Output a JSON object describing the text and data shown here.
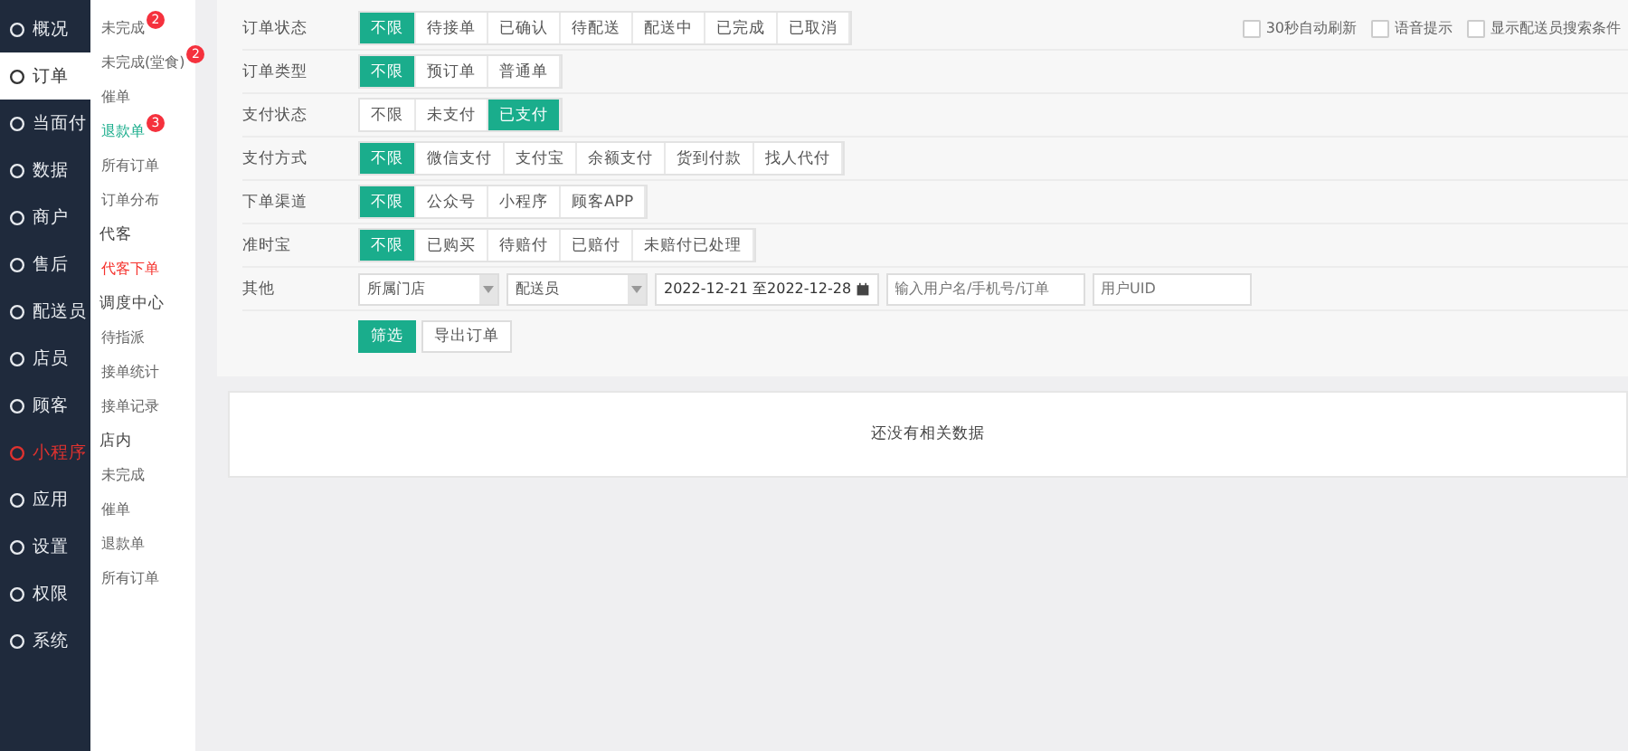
{
  "sidebar": {
    "items": [
      {
        "label": "概况",
        "selected": false
      },
      {
        "label": "订单",
        "selected": true
      },
      {
        "label": "当面付",
        "selected": false
      },
      {
        "label": "数据",
        "selected": false
      },
      {
        "label": "商户",
        "selected": false
      },
      {
        "label": "售后",
        "selected": false
      },
      {
        "label": "配送员",
        "selected": false
      },
      {
        "label": "店员",
        "selected": false
      },
      {
        "label": "顾客",
        "selected": false
      },
      {
        "label": "小程序",
        "selected": false,
        "color": "#e0322f"
      },
      {
        "label": "应用",
        "selected": false
      },
      {
        "label": "设置",
        "selected": false
      },
      {
        "label": "权限",
        "selected": false
      },
      {
        "label": "系统",
        "selected": false
      }
    ]
  },
  "submenu": {
    "items": [
      {
        "kind": "link",
        "label": "未完成",
        "badge": "2"
      },
      {
        "kind": "link",
        "label": "未完成(堂食)",
        "badge": "2"
      },
      {
        "kind": "link",
        "label": "催单"
      },
      {
        "kind": "link",
        "label": "退款单",
        "badge": "3",
        "color": "#1aad8c"
      },
      {
        "kind": "link",
        "label": "所有订单"
      },
      {
        "kind": "link",
        "label": "订单分布"
      },
      {
        "kind": "header",
        "label": "代客"
      },
      {
        "kind": "link",
        "label": "代客下单",
        "color": "#f5312c"
      },
      {
        "kind": "header",
        "label": "调度中心"
      },
      {
        "kind": "link",
        "label": "待指派"
      },
      {
        "kind": "link",
        "label": "接单统计"
      },
      {
        "kind": "link",
        "label": "接单记录"
      },
      {
        "kind": "header",
        "label": "店内"
      },
      {
        "kind": "link",
        "label": "未完成"
      },
      {
        "kind": "link",
        "label": "催单"
      },
      {
        "kind": "link",
        "label": "退款单"
      },
      {
        "kind": "link",
        "label": "所有订单"
      }
    ]
  },
  "options": [
    {
      "label": "30秒自动刷新",
      "checked": false
    },
    {
      "label": "语音提示",
      "checked": false
    },
    {
      "label": "显示配送员搜索条件",
      "checked": false
    }
  ],
  "filters": [
    {
      "label": "订单状态",
      "buttons": [
        {
          "label": "不限",
          "selected": true
        },
        {
          "label": "待接单",
          "selected": false
        },
        {
          "label": "已确认",
          "selected": false
        },
        {
          "label": "待配送",
          "selected": false
        },
        {
          "label": "配送中",
          "selected": false
        },
        {
          "label": "已完成",
          "selected": false
        },
        {
          "label": "已取消",
          "selected": false
        }
      ]
    },
    {
      "label": "订单类型",
      "buttons": [
        {
          "label": "不限",
          "selected": true
        },
        {
          "label": "预订单",
          "selected": false
        },
        {
          "label": "普通单",
          "selected": false
        }
      ]
    },
    {
      "label": "支付状态",
      "buttons": [
        {
          "label": "不限",
          "selected": false
        },
        {
          "label": "未支付",
          "selected": false
        },
        {
          "label": "已支付",
          "selected": true
        }
      ]
    },
    {
      "label": "支付方式",
      "buttons": [
        {
          "label": "不限",
          "selected": true
        },
        {
          "label": "微信支付",
          "selected": false
        },
        {
          "label": "支付宝",
          "selected": false
        },
        {
          "label": "余额支付",
          "selected": false
        },
        {
          "label": "货到付款",
          "selected": false
        },
        {
          "label": "找人代付",
          "selected": false
        }
      ]
    },
    {
      "label": "下单渠道",
      "buttons": [
        {
          "label": "不限",
          "selected": true
        },
        {
          "label": "公众号",
          "selected": false
        },
        {
          "label": "小程序",
          "selected": false
        },
        {
          "label": "顾客APP",
          "selected": false
        }
      ]
    },
    {
      "label": "准时宝",
      "buttons": [
        {
          "label": "不限",
          "selected": true
        },
        {
          "label": "已购买",
          "selected": false
        },
        {
          "label": "待赔付",
          "selected": false
        },
        {
          "label": "已赔付",
          "selected": false
        },
        {
          "label": "未赔付已处理",
          "selected": false
        }
      ]
    }
  ],
  "other": {
    "label": "其他",
    "store_select": "所属门店",
    "courier_select": "配送员",
    "date_range": "2022-12-21 至2022-12-28",
    "user_search": {
      "placeholder": "输入用户名/手机号/订单"
    },
    "uid_search": {
      "placeholder": "用户UID"
    }
  },
  "actions": [
    {
      "label": "筛选",
      "kind": "primary"
    },
    {
      "label": "导出订单",
      "kind": "default"
    }
  ],
  "empty_message": "还没有相关数据"
}
